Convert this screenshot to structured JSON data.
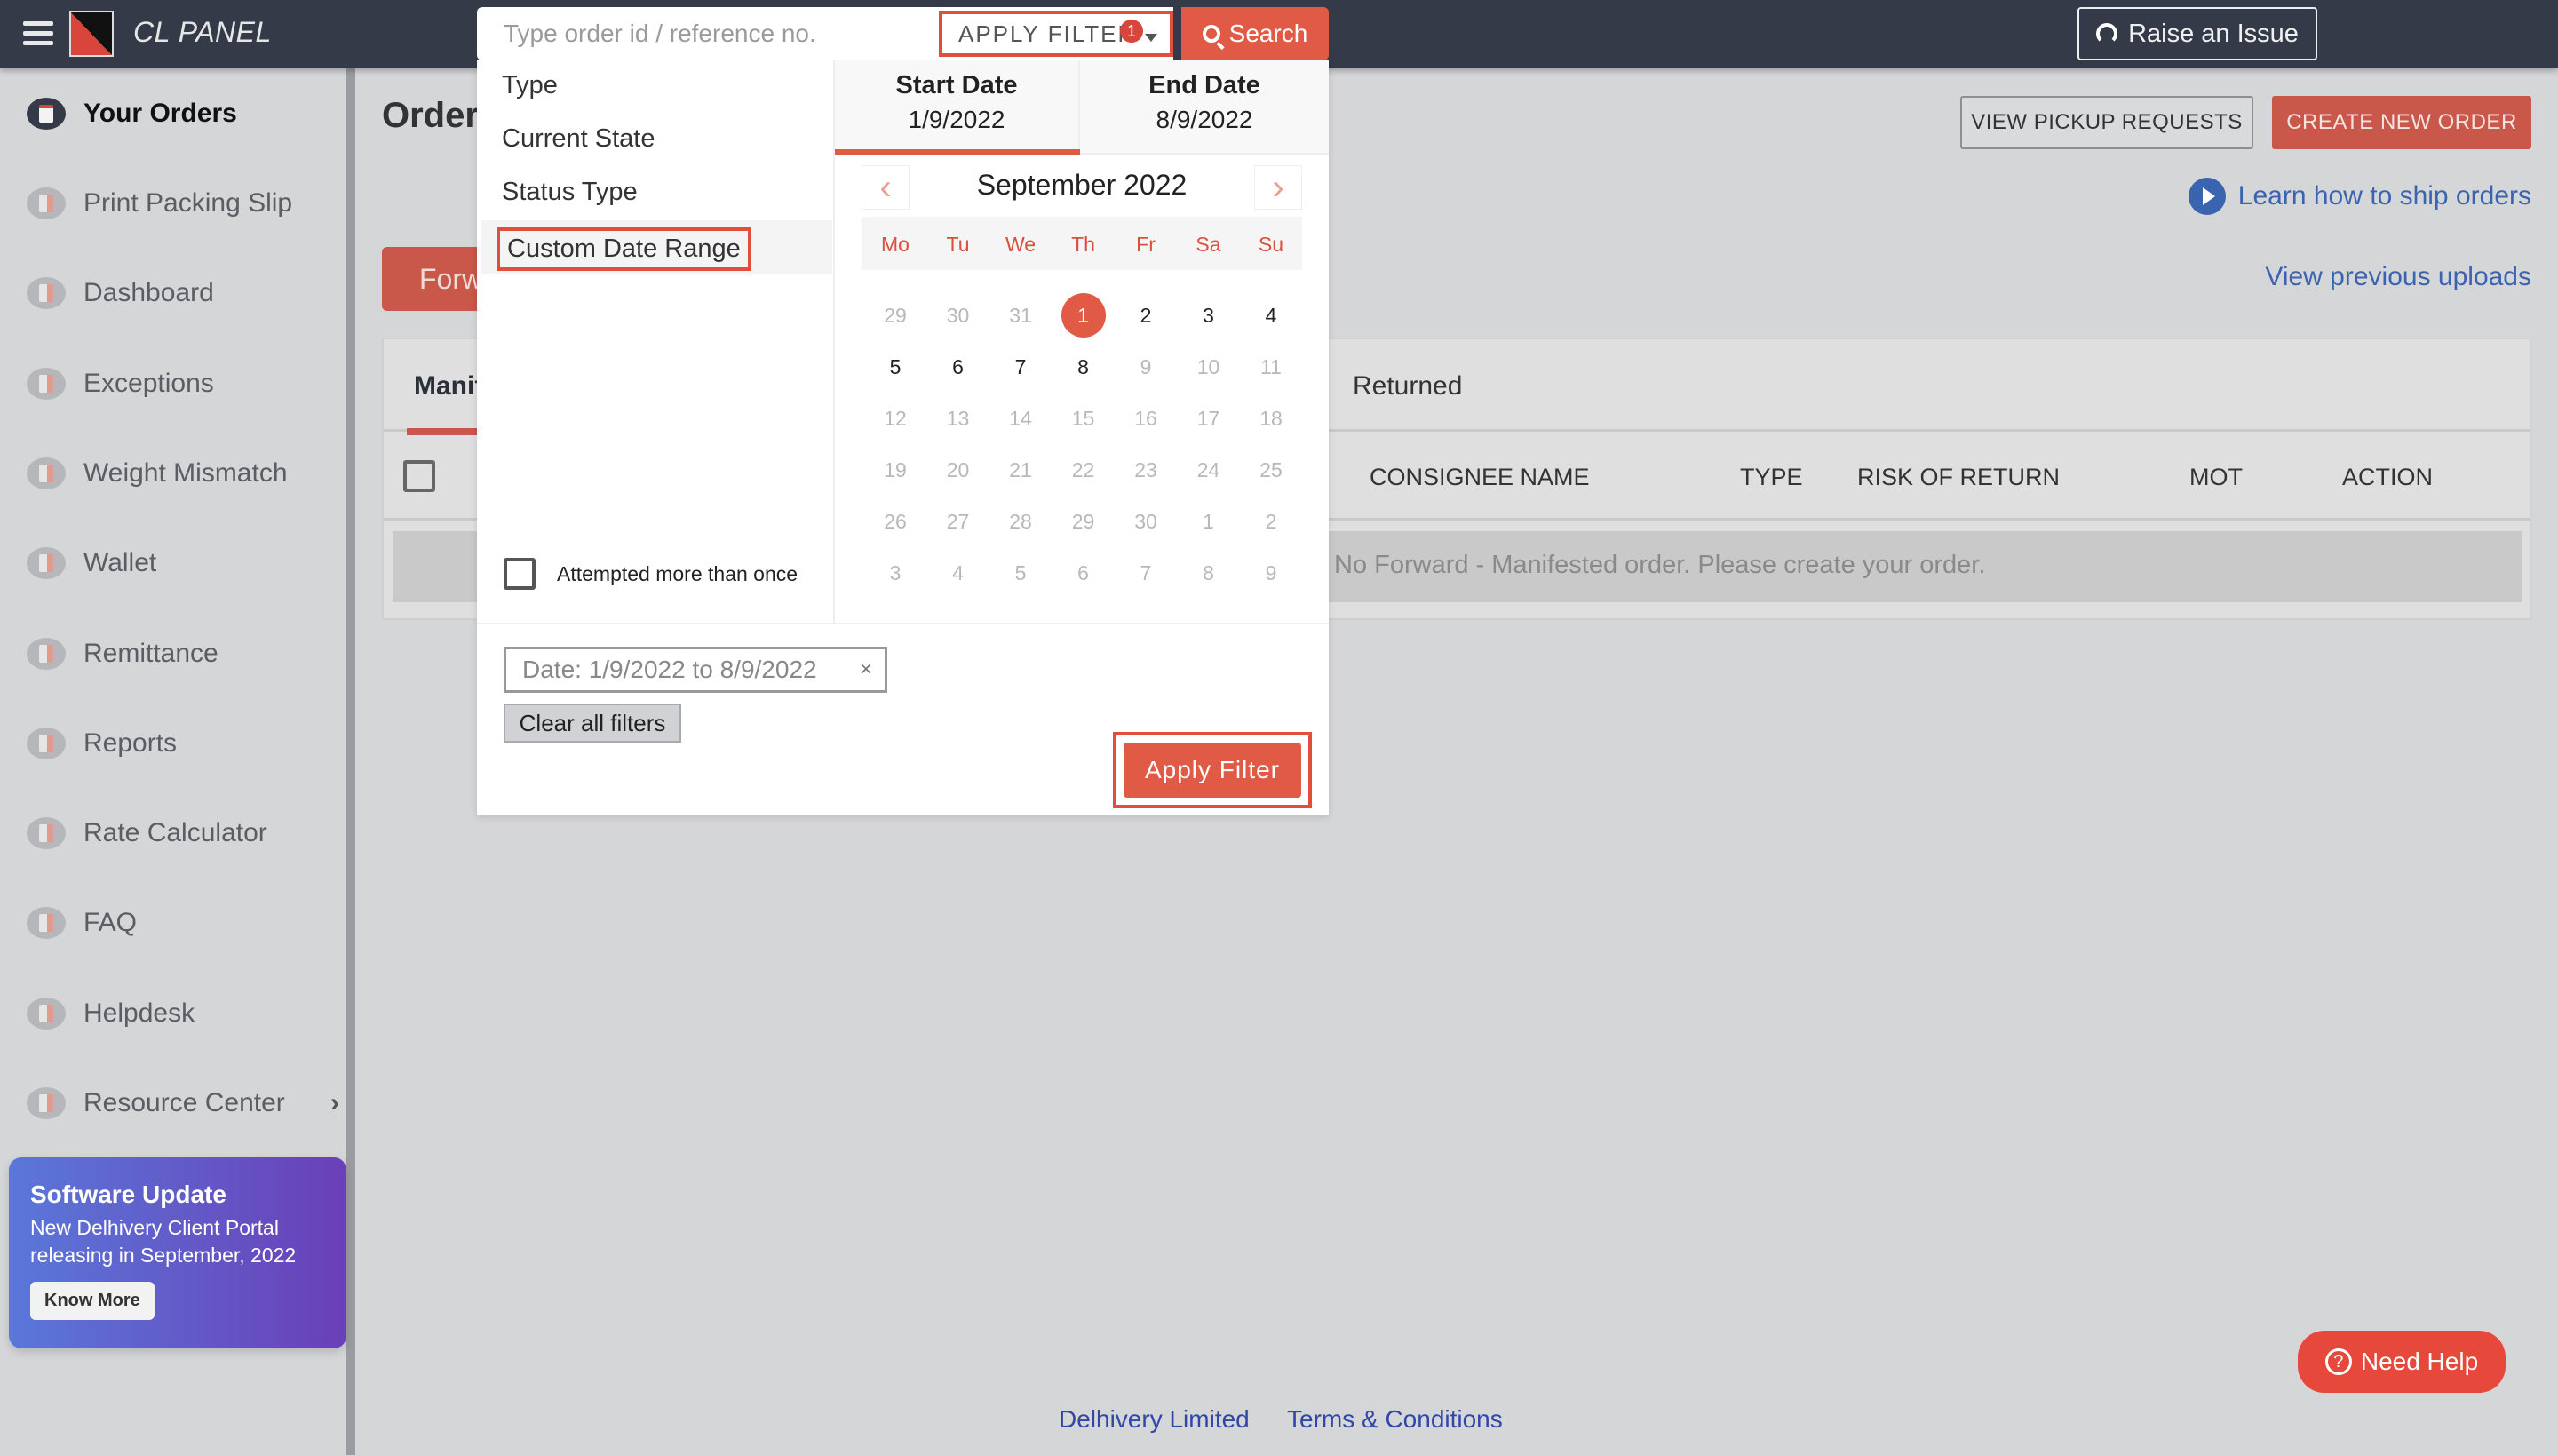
{
  "header": {
    "brand": "CL PANEL",
    "search_placeholder": "Type order id / reference no.",
    "search_value": "",
    "apply_filter_label": "APPLY FILTER",
    "filter_count": "1",
    "search_label": "Search",
    "raise_issue_label": "Raise an Issue"
  },
  "sidebar": {
    "items": [
      {
        "label": "Your Orders",
        "icon": "clipboard-icon",
        "active": true
      },
      {
        "label": "Print Packing Slip",
        "icon": "printer-icon"
      },
      {
        "label": "Dashboard",
        "icon": "pie-chart-icon"
      },
      {
        "label": "Exceptions",
        "icon": "document-icon"
      },
      {
        "label": "Weight Mismatch",
        "icon": "document-icon"
      },
      {
        "label": "Wallet",
        "icon": "wallet-icon"
      },
      {
        "label": "Remittance",
        "icon": "remittance-icon"
      },
      {
        "label": "Reports",
        "icon": "clipboard-icon"
      },
      {
        "label": "Rate Calculator",
        "icon": "calculator-icon"
      },
      {
        "label": "FAQ",
        "icon": "chat-icon"
      },
      {
        "label": "Helpdesk",
        "icon": "chat-icon"
      },
      {
        "label": "Resource Center",
        "icon": "gears-icon",
        "chevron": "›"
      }
    ],
    "promo": {
      "title": "Software Update",
      "text": "New Delhivery Client Portal releasing in September, 2022",
      "button": "Know More"
    }
  },
  "main": {
    "title": "Orders",
    "view_pickup_label": "VIEW PICKUP REQUESTS",
    "create_order_label": "CREATE NEW ORDER",
    "learn_link": "Learn how to ship orders",
    "prev_uploads_link": "View previous uploads",
    "forward_button": "Forward",
    "tabs": [
      {
        "label": "Manifested",
        "active": true
      },
      {
        "label": "Returned"
      }
    ],
    "columns": [
      "CONSIGNEE NAME",
      "TYPE",
      "RISK OF RETURN",
      "MOT",
      "ACTION"
    ],
    "empty_message": "No Forward - Manifested order. Please create your order."
  },
  "filter": {
    "options": [
      "Type",
      "Current State",
      "Status Type",
      "Custom Date Range"
    ],
    "selected_option": "Custom Date Range",
    "attempted_label": "Attempted more than once",
    "attempted_checked": false,
    "start_date_label": "Start Date",
    "start_date": "1/9/2022",
    "end_date_label": "End Date",
    "end_date": "8/9/2022",
    "calendar": {
      "month_label": "September 2022",
      "prev": "‹",
      "next": "›",
      "weekdays": [
        "Mo",
        "Tu",
        "We",
        "Th",
        "Fr",
        "Sa",
        "Su"
      ],
      "weeks": [
        [
          [
            "29",
            "muted"
          ],
          [
            "30",
            "muted"
          ],
          [
            "31",
            "muted"
          ],
          [
            "1",
            "sel"
          ],
          [
            "2",
            "normal"
          ],
          [
            "3",
            "normal"
          ],
          [
            "4",
            "normal"
          ]
        ],
        [
          [
            "5",
            "normal"
          ],
          [
            "6",
            "normal"
          ],
          [
            "7",
            "normal"
          ],
          [
            "8",
            "normal"
          ],
          [
            "9",
            "muted"
          ],
          [
            "10",
            "muted"
          ],
          [
            "11",
            "muted"
          ]
        ],
        [
          [
            "12",
            "muted"
          ],
          [
            "13",
            "muted"
          ],
          [
            "14",
            "muted"
          ],
          [
            "15",
            "muted"
          ],
          [
            "16",
            "muted"
          ],
          [
            "17",
            "muted"
          ],
          [
            "18",
            "muted"
          ]
        ],
        [
          [
            "19",
            "muted"
          ],
          [
            "20",
            "muted"
          ],
          [
            "21",
            "muted"
          ],
          [
            "22",
            "muted"
          ],
          [
            "23",
            "muted"
          ],
          [
            "24",
            "muted"
          ],
          [
            "25",
            "muted"
          ]
        ],
        [
          [
            "26",
            "muted"
          ],
          [
            "27",
            "muted"
          ],
          [
            "28",
            "muted"
          ],
          [
            "29",
            "muted"
          ],
          [
            "30",
            "muted"
          ],
          [
            "1",
            "muted"
          ],
          [
            "2",
            "muted"
          ]
        ],
        [
          [
            "3",
            "muted"
          ],
          [
            "4",
            "muted"
          ],
          [
            "5",
            "muted"
          ],
          [
            "6",
            "muted"
          ],
          [
            "7",
            "muted"
          ],
          [
            "8",
            "muted"
          ],
          [
            "9",
            "muted"
          ]
        ]
      ]
    },
    "active_chip": "Date: 1/9/2022 to 8/9/2022",
    "chip_remove": "×",
    "clear_all_label": "Clear all filters",
    "apply_label": "Apply Filter"
  },
  "footer": {
    "links": [
      "Delhivery Limited",
      "Terms & Conditions"
    ],
    "need_help": "Need Help",
    "need_help_icon": "?"
  },
  "colors": {
    "accent": "#e05a45",
    "topbar": "#343a47",
    "link": "#3a63b0"
  }
}
